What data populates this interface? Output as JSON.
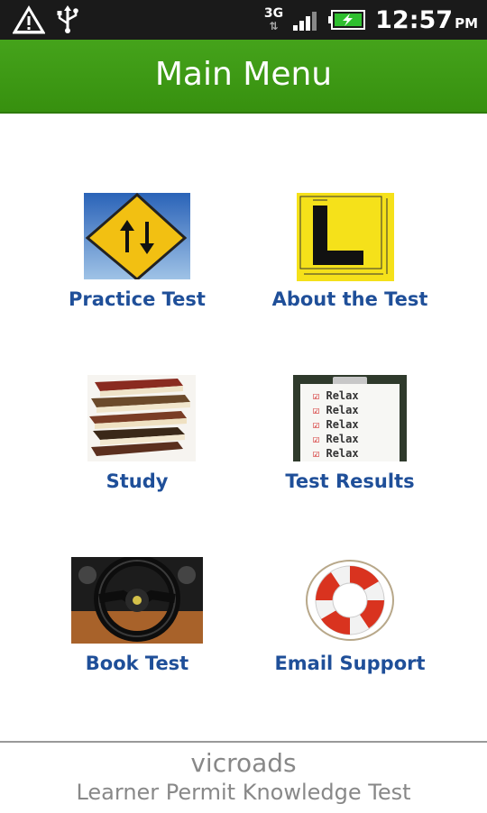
{
  "status_bar": {
    "network": "3G",
    "time": "12:57",
    "ampm": "PM",
    "icons": [
      "warning-icon",
      "usb-icon",
      "signal-icon",
      "battery-charging-icon"
    ]
  },
  "header": {
    "title": "Main Menu",
    "bg_color": "#3f9a18"
  },
  "menu": [
    {
      "label": "Practice Test",
      "icon": "road-sign-icon"
    },
    {
      "label": "About the Test",
      "icon": "l-plate-icon"
    },
    {
      "label": "Study",
      "icon": "books-icon"
    },
    {
      "label": "Test Results",
      "icon": "clipboard-checklist-icon"
    },
    {
      "label": "Book Test",
      "icon": "steering-wheel-icon"
    },
    {
      "label": "Email Support",
      "icon": "lifebuoy-icon"
    }
  ],
  "clipboard_lines": [
    "Relax",
    "Relax",
    "Relax",
    "Relax",
    "Relax"
  ],
  "footer": {
    "line1": "vicroads",
    "line2": "Learner Permit Knowledge Test"
  },
  "colors": {
    "label": "#1f4f99",
    "footer_text": "#888888"
  }
}
